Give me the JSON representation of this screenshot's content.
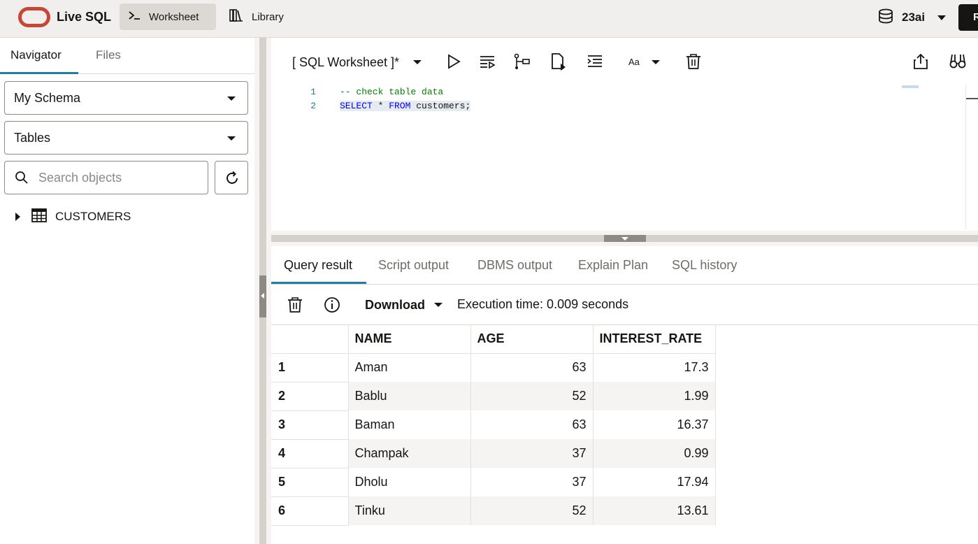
{
  "topbar": {
    "brand": "Live SQL",
    "nav": [
      {
        "label": "Worksheet",
        "active": true,
        "icon": "terminal-icon"
      },
      {
        "label": "Library",
        "active": false,
        "icon": "library-icon"
      }
    ],
    "database": "23ai",
    "right_button": "R"
  },
  "navigator": {
    "tabs": [
      {
        "label": "Navigator",
        "active": true
      },
      {
        "label": "Files",
        "active": false
      }
    ],
    "schema_select": "My Schema",
    "object_type_select": "Tables",
    "search_placeholder": "Search objects",
    "tree": [
      {
        "label": "CUSTOMERS",
        "icon": "table-icon",
        "expanded": false
      }
    ]
  },
  "worksheet": {
    "title": "[ SQL Worksheet ]*",
    "font_button": "Aa",
    "code_lines": [
      {
        "num": "1",
        "text": "-- check table data"
      },
      {
        "num": "2",
        "text": "SELECT * FROM customers;"
      }
    ]
  },
  "results": {
    "tabs": [
      {
        "label": "Query result",
        "active": true
      },
      {
        "label": "Script output",
        "active": false
      },
      {
        "label": "DBMS output",
        "active": false
      },
      {
        "label": "Explain Plan",
        "active": false
      },
      {
        "label": "SQL history",
        "active": false
      }
    ],
    "download_label": "Download",
    "execution_time": "Execution time: 0.009 seconds",
    "columns": [
      "NAME",
      "AGE",
      "INTEREST_RATE"
    ],
    "rows": [
      {
        "n": "1",
        "name": "Aman",
        "age": "63",
        "rate": "17.3"
      },
      {
        "n": "2",
        "name": "Bablu",
        "age": "52",
        "rate": "1.99"
      },
      {
        "n": "3",
        "name": "Baman",
        "age": "63",
        "rate": "16.37"
      },
      {
        "n": "4",
        "name": "Champak",
        "age": "37",
        "rate": "0.99"
      },
      {
        "n": "5",
        "name": "Dholu",
        "age": "37",
        "rate": "17.94"
      },
      {
        "n": "6",
        "name": "Tinku",
        "age": "52",
        "rate": "13.61"
      }
    ]
  },
  "colors": {
    "accent": "#227e9e",
    "brand_red": "#c74634",
    "topbar_bg": "#f1efed"
  }
}
